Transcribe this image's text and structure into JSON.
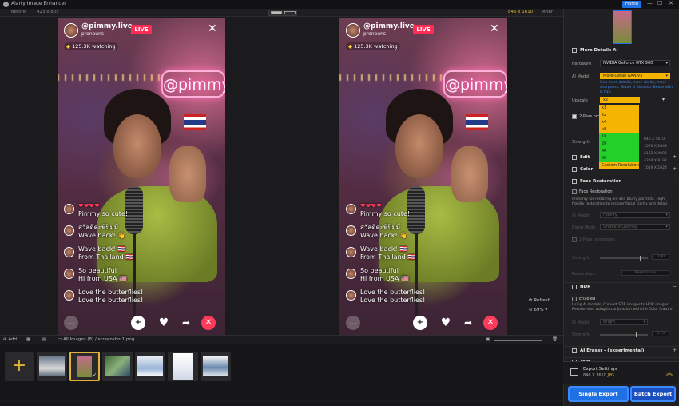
{
  "app": {
    "title": "Aiarty Image Enhancer",
    "home_label": "Home"
  },
  "window": {
    "minimize": "—",
    "maximize": "☐",
    "close": "✕"
  },
  "viewbar": {
    "before_label": "Before",
    "before_res": "423 x 805",
    "after_res": "846 x 1610",
    "after_label": "After"
  },
  "stream": {
    "username": "@pimmy.live",
    "subtitle": "pronouns",
    "live_badge": "LIVE",
    "watching": "125.3K watching",
    "neon_text": "@pimmy.liv",
    "comments": [
      {
        "text": "Pimmy so cute!",
        "hearts": "❤❤❤❤"
      },
      {
        "text": "สวัสดีค่ะพี่ปิมมี่\nWave back! 👋"
      },
      {
        "text": "Wave back! 🇹🇭\nFrom Thailand 🇹🇭"
      },
      {
        "text": "So beautiful\nHi from USA 🇺🇸"
      },
      {
        "text": "Love the butterflies!\nLove the butterflies!"
      }
    ]
  },
  "canvas_tools": {
    "refresh": "Refresh",
    "zoom": "69%"
  },
  "panel": {
    "more_details": "More Details AI",
    "hardware_label": "Hardware",
    "hardware_value": "NVIDIA GeForce GTX 960",
    "model_label": "AI Model",
    "model_value": "More-Detail GAN v3",
    "model_note": "Gen more details, more clarity, more sharpness. Better 4 Denoise, Better skin & hair.",
    "upscale_label": "Upscale",
    "upscale_value": "x2",
    "upscale_options": [
      "x1",
      "x2",
      "x4",
      "x8",
      "1K",
      "2K",
      "4K",
      "8K",
      "Custom Resolution"
    ],
    "upscale_dims": [
      "846 X 1610",
      "1076 X 2048",
      "2152 X 4096",
      "4304 X 8192",
      "1019 X 1024"
    ],
    "twopass": "2-Pass proc",
    "strength_label": "Strength",
    "edit_label": "Edit",
    "color_label": "Color",
    "face_restoration": "Face Restoration",
    "face_checkbox": "Face Restoration",
    "face_hint": "Primarily for restoring old and blurry portraits. High-fidelity restoration to recover facial clarity and detail.",
    "ai_model2_label": "AI Model",
    "ai_model2_value": "Fidelity",
    "blend_label": "Blend Mode",
    "blend_value": "Gradient Overlay",
    "twopass2": "2-Pass processing",
    "strength2_label": "Strength",
    "strength2_value": "0.90",
    "restore_label": "Restoration",
    "reset_faces": "Reset Faces",
    "hdr": "HDR",
    "hdr_enabled": "Enabled",
    "hdr_hint": "Using AI models, Convert SDR images to HDR images. Recommend using in conjunction with the Color feature.",
    "hdr_mode_label": "AI Model",
    "hdr_mode_value": "Bright",
    "hdr_strength_label": "Strength",
    "hdr_strength_value": "0.75",
    "eraser": "AI Eraser - (experimental)",
    "text_label": "Text"
  },
  "export": {
    "title": "Export Settings",
    "dims": "846 X 1610",
    "format": "JPG",
    "single": "Single Export",
    "batch": "Batch Export"
  },
  "strip": {
    "add": "Add",
    "all_images": "All Images (8)",
    "separator": "/",
    "current_file": "screenshot1.png"
  }
}
